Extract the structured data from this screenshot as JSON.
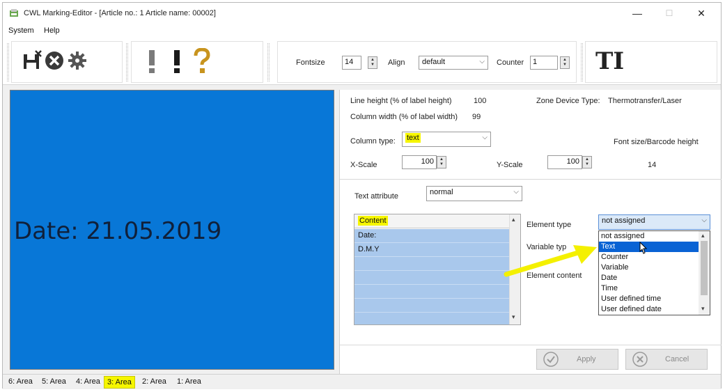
{
  "window": {
    "title": "CWL Marking-Editor - [Article no.: 1   Article name: 00002]",
    "minimize": "—",
    "maximize": "☐",
    "close": "✕"
  },
  "menu": {
    "system": "System",
    "help": "Help"
  },
  "toolbar": {
    "fontsize_label": "Fontsize",
    "fontsize_value": "14",
    "align_label": "Align",
    "align_value": "default",
    "counter_label": "Counter",
    "counter_value": "1",
    "text_tool_glyph": "TI"
  },
  "preview": {
    "text": "Date:  21.05.2019",
    "background": "#0877d7"
  },
  "settings": {
    "line_height_label": "Line height (% of label height)",
    "line_height_value": "100",
    "zone_device_label": "Zone Device Type:",
    "zone_device_value": "Thermotransfer/Laser",
    "column_width_label": "Column width (% of label width)",
    "column_width_value": "99",
    "column_type_label": "Column type:",
    "column_type_value": "text",
    "font_size_label": "Font size/Barcode height",
    "font_size_value": "14",
    "xscale_label": "X-Scale",
    "xscale_value": "100",
    "yscale_label": "Y-Scale",
    "yscale_value": "100",
    "text_attribute_label": "Text attribute",
    "text_attribute_value": "normal"
  },
  "content": {
    "header": "Content",
    "rows": [
      "Date:",
      "D.M.Y",
      "",
      "",
      "",
      "",
      ""
    ]
  },
  "element": {
    "type_label": "Element type",
    "type_value": "not assigned",
    "variable_label": "Variable typ",
    "content_label": "Element content",
    "options": [
      "not assigned",
      "Text",
      "Counter",
      "Variable",
      "Date",
      "Time",
      "User defined time",
      "User defined date"
    ],
    "selected_index": 1
  },
  "buttons": {
    "apply": "Apply",
    "cancel": "Cancel"
  },
  "tabs": [
    "6: Area",
    "5: Area",
    "4: Area",
    "3: Area",
    "2: Area",
    "1: Area"
  ],
  "active_tab_index": 3,
  "highlight_color": "#f6f600"
}
